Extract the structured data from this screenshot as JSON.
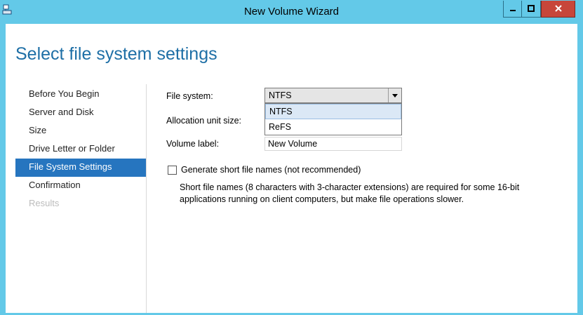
{
  "window": {
    "title": "New Volume Wizard",
    "icon": "disk-wizard-icon",
    "controls": {
      "minimize": "minimize-icon",
      "maximize": "maximize-icon",
      "close": "close-icon"
    }
  },
  "page": {
    "title": "Select file system settings"
  },
  "nav": {
    "items": [
      {
        "label": "Before You Begin",
        "state": "normal"
      },
      {
        "label": "Server and Disk",
        "state": "normal"
      },
      {
        "label": "Size",
        "state": "normal"
      },
      {
        "label": "Drive Letter or Folder",
        "state": "normal"
      },
      {
        "label": "File System Settings",
        "state": "active"
      },
      {
        "label": "Confirmation",
        "state": "normal"
      },
      {
        "label": "Results",
        "state": "disabled"
      }
    ]
  },
  "form": {
    "file_system_label": "File system:",
    "file_system_value": "NTFS",
    "file_system_options": [
      "NTFS",
      "ReFS"
    ],
    "allocation_label": "Allocation unit size:",
    "volume_label_label": "Volume label:",
    "volume_label_value": "New Volume",
    "short_names_label": "Generate short file names (not recommended)",
    "short_names_checked": false,
    "short_names_desc": "Short file names (8 characters with 3-character extensions) are required for some 16-bit applications running on client computers, but make file operations slower."
  },
  "colors": {
    "titlebar": "#63c9e8",
    "accent": "#2675bf",
    "title_text": "#1e6fa6",
    "close_button": "#c7463a"
  }
}
